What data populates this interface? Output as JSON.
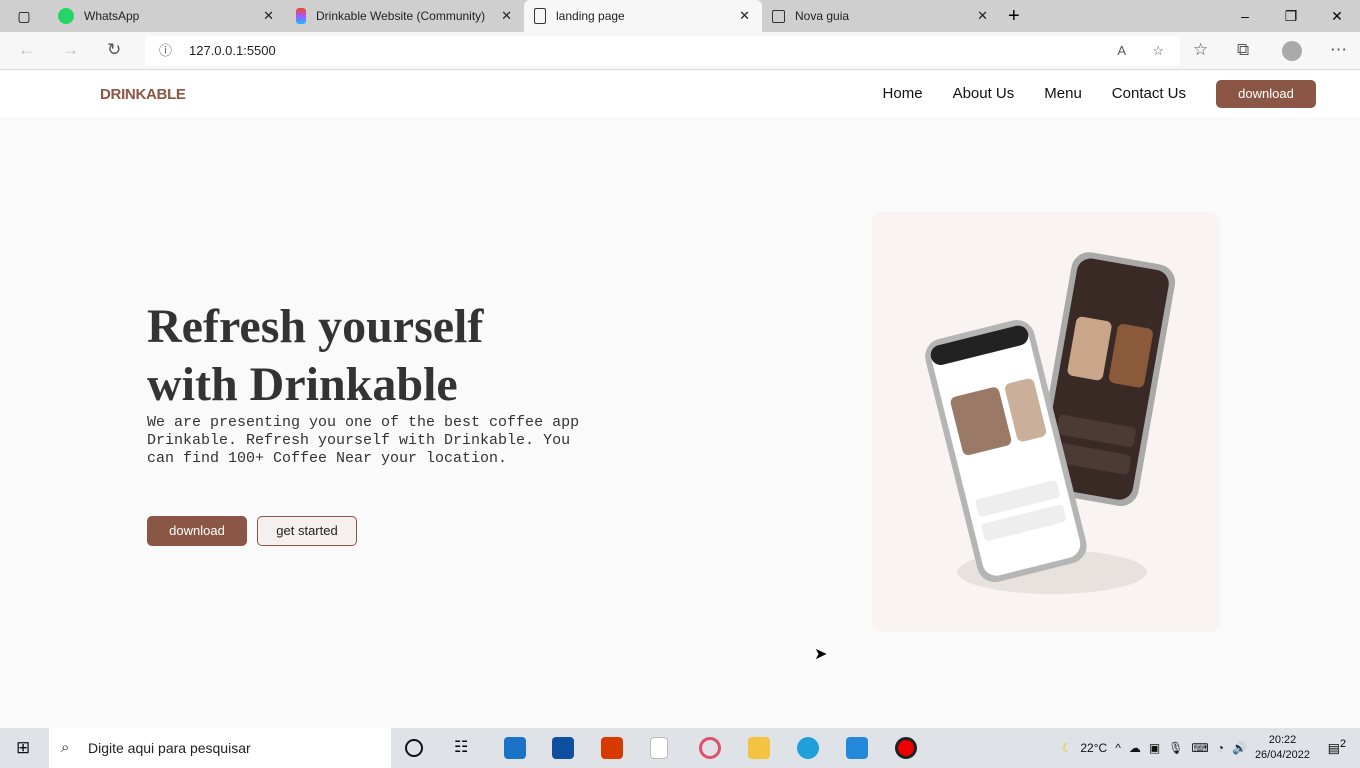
{
  "browser": {
    "tabs": [
      {
        "label": "WhatsApp",
        "icon": "whatsapp-icon"
      },
      {
        "label": "Drinkable Website (Community)",
        "icon": "figma-icon"
      },
      {
        "label": "landing page",
        "icon": "page-icon",
        "active": true
      },
      {
        "label": "Nova guia",
        "icon": "new-tab-icon"
      }
    ],
    "url": "127.0.0.1:5500"
  },
  "site": {
    "logo": "DRINKABLE",
    "nav": [
      "Home",
      "About Us",
      "Menu",
      "Contact Us"
    ],
    "nav_button": "download",
    "hero": {
      "title_line1": "Refresh yourself",
      "title_line2": "with Drinkable",
      "description": "We are presenting you one of the best coffee app Drinkable. Refresh yourself with Drinkable. You can find 100+ Coffee Near your location.",
      "primary_button": "download",
      "secondary_button": "get started"
    },
    "accent": "#8b5646"
  },
  "taskbar": {
    "search_placeholder": "Digite aqui para pesquisar",
    "temperature": "22°C",
    "time": "20:22",
    "date": "26/04/2022",
    "notifications": "2"
  }
}
